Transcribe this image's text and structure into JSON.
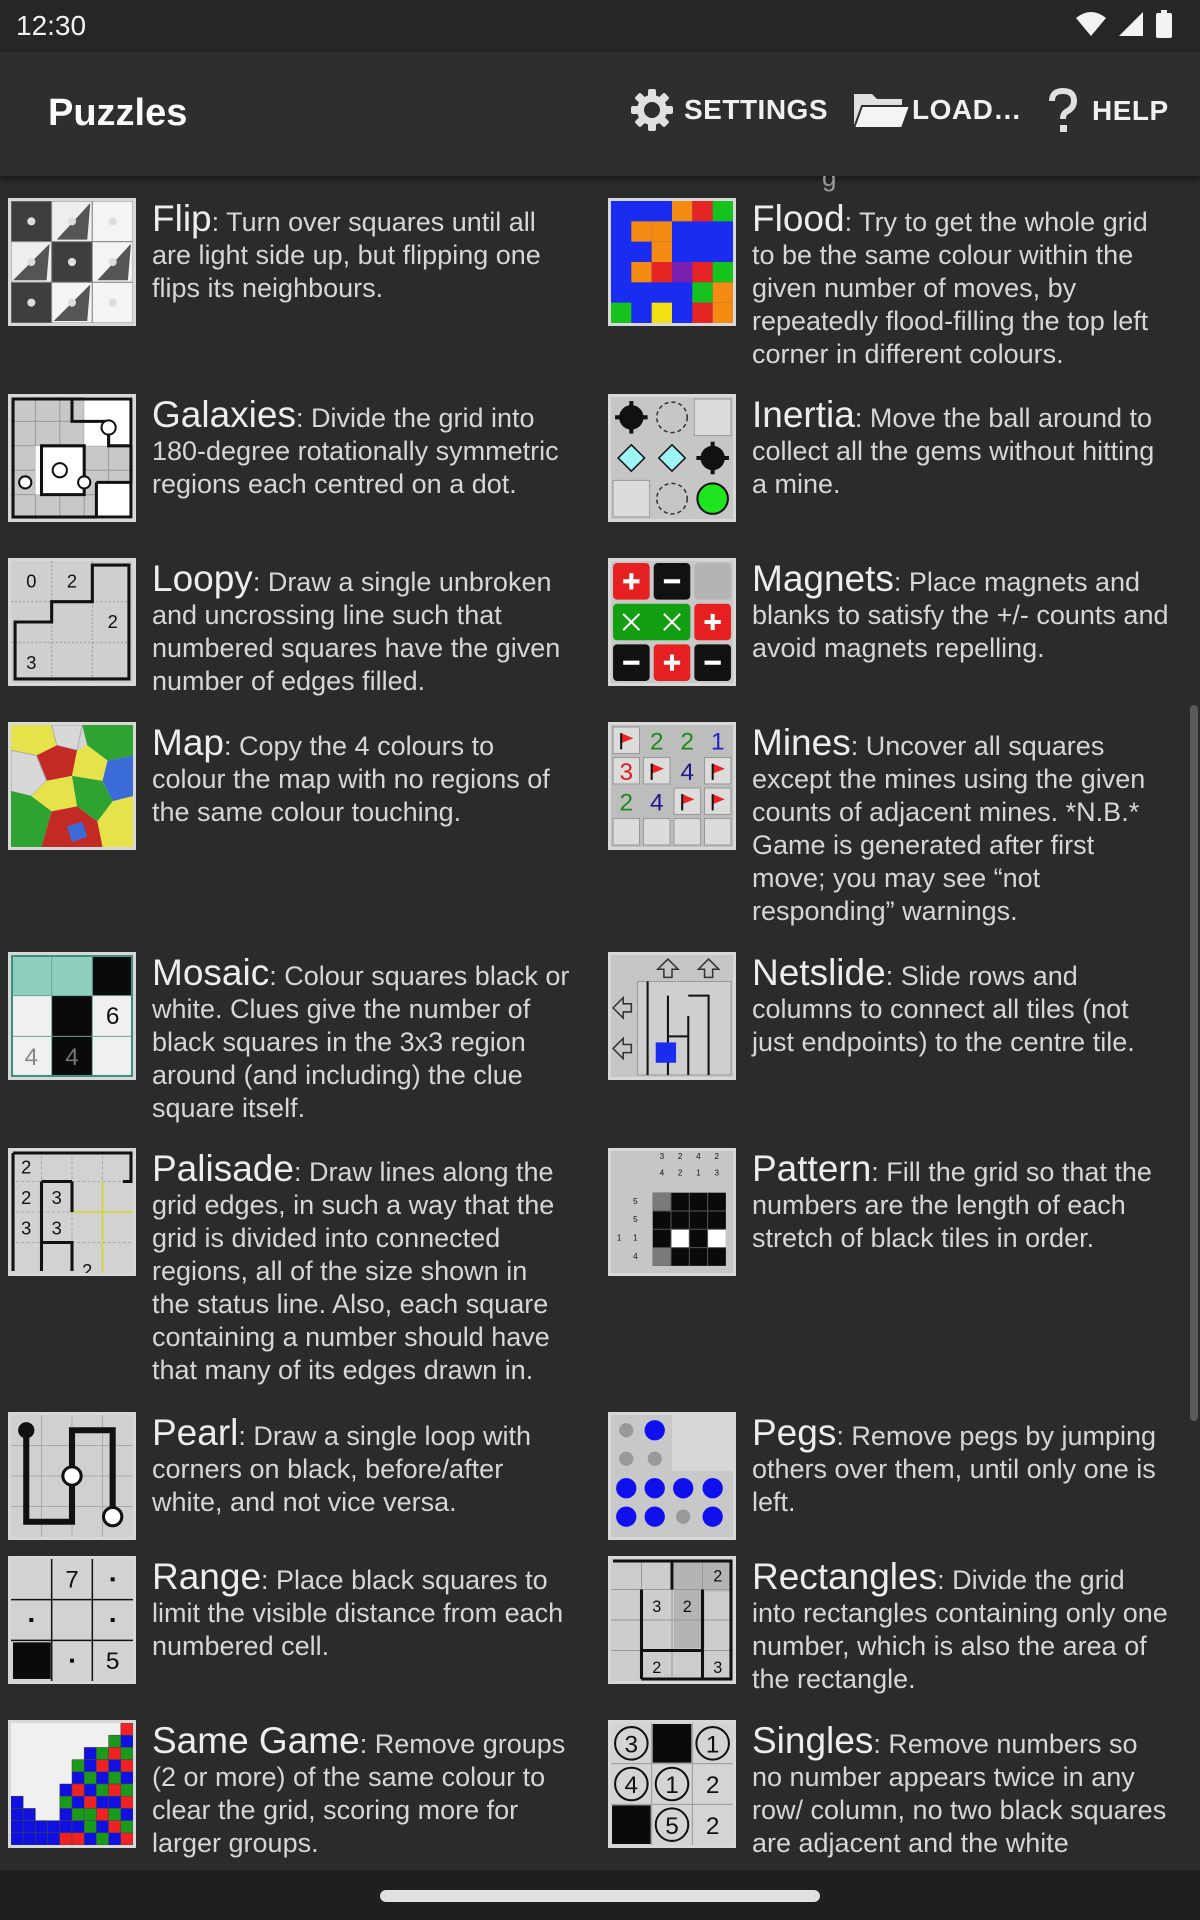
{
  "status": {
    "time": "12:30",
    "icons": [
      "wifi-icon",
      "signal-icon",
      "battery-icon"
    ]
  },
  "app_bar": {
    "title": "Puzzles",
    "actions": [
      {
        "label": "SETTINGS",
        "icon": "gear-icon"
      },
      {
        "label": "LOAD…",
        "icon": "folder-icon"
      },
      {
        "label": "HELP",
        "icon": "question-icon"
      }
    ]
  },
  "puzzles": [
    {
      "name": "Flip",
      "desc": ": Turn over squares until all are light side up, but flipping one flips its neighbours."
    },
    {
      "name": "Flood",
      "desc": ": Try to get the whole grid to be the same colour within the given number of moves, by repeatedly flood-filling the top left corner in different colours."
    },
    {
      "name": "Galaxies",
      "desc": ": Divide the grid into 180-degree rotationally symmetric regions each centred on a dot."
    },
    {
      "name": "Inertia",
      "desc": ": Move the ball around to collect all the gems without hitting a mine."
    },
    {
      "name": "Loopy",
      "desc": ": Draw a single unbroken and uncrossing line such that numbered squares have the given number of edges filled."
    },
    {
      "name": "Magnets",
      "desc": ": Place magnets and blanks to satisfy the +/- counts and avoid magnets repelling."
    },
    {
      "name": "Map",
      "desc": ": Copy the 4 colours to colour the map with no regions of the same colour touching."
    },
    {
      "name": "Mines",
      "desc": ": Uncover all squares except the mines using the given counts of adjacent mines. *N.B.* Game is generated after first move; you may see “not responding” warnings."
    },
    {
      "name": "Mosaic",
      "desc": ": Colour squares black or white. Clues give the number of black squares in the 3x3 region around (and including) the clue square itself."
    },
    {
      "name": "Netslide",
      "desc": ": Slide rows and columns to connect all tiles (not just endpoints) to the centre tile."
    },
    {
      "name": "Palisade",
      "desc": ": Draw lines along the grid edges, in such a way that the grid is divided into connected regions, all of the size shown in the status line. Also, each square containing a number should have that many of its edges drawn in."
    },
    {
      "name": "Pattern",
      "desc": ": Fill the grid so that the numbers are the length of each stretch of black tiles in order."
    },
    {
      "name": "Pearl",
      "desc": ": Draw a single loop with corners on black, before/after white, and not vice versa."
    },
    {
      "name": "Pegs",
      "desc": ": Remove pegs by jumping others over them, until only one is left."
    },
    {
      "name": "Range",
      "desc": ": Place black squares to limit the visible distance from each numbered cell."
    },
    {
      "name": "Rectangles",
      "desc": ": Divide the grid into rectangles containing only one number, which is also the area of the rectangle."
    },
    {
      "name": "Same Game",
      "desc": ": Remove groups (2 or more) of the same colour to clear the grid, scoring more for larger groups."
    },
    {
      "name": "Singles",
      "desc": ": Remove numbers so no number appears twice in any row/ column, no two black squares are adjacent and the white squares"
    }
  ],
  "thumb_text": {
    "loopy": [
      "0",
      "2",
      "2",
      "3"
    ],
    "mines": [
      "2",
      "2",
      "1",
      "3",
      "4",
      "2",
      "4"
    ],
    "mosaic": [
      "6",
      "4",
      "4"
    ],
    "palisade": [
      "2",
      "2",
      "3",
      "3",
      "3",
      "2"
    ],
    "pattern": [
      "3",
      "2",
      "4",
      "2",
      "4",
      "2",
      "1",
      "3",
      "5",
      "5",
      "1",
      "1",
      "4"
    ],
    "range": [
      "7",
      "5"
    ],
    "rectangles": [
      "2",
      "3",
      "2",
      "2",
      "3"
    ],
    "singles": [
      "3",
      "1",
      "4",
      "1",
      "2",
      "5",
      "2"
    ]
  }
}
